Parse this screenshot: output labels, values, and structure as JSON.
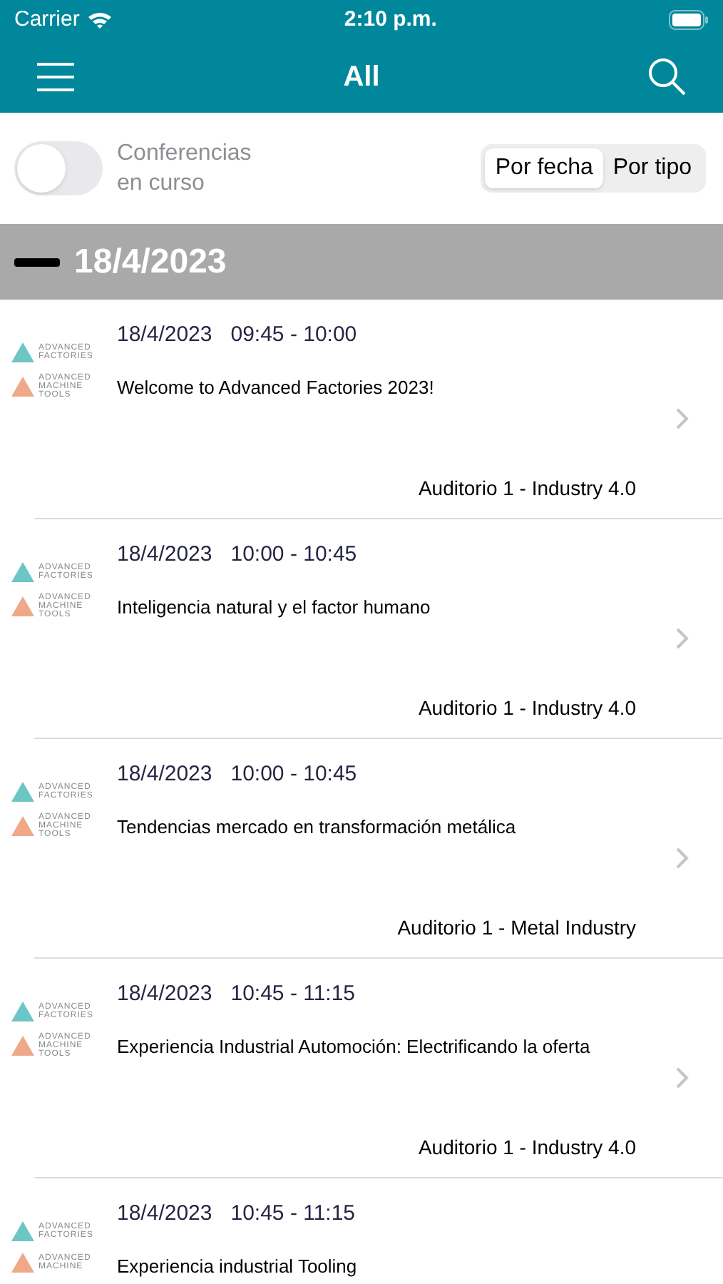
{
  "status_bar": {
    "carrier": "Carrier",
    "time": "2:10 p.m."
  },
  "nav": {
    "title": "All"
  },
  "filter": {
    "toggle_label": "Conferencias en curso",
    "on": false,
    "segments": [
      {
        "label": "Por fecha",
        "selected": true
      },
      {
        "label": "Por tipo",
        "selected": false
      }
    ]
  },
  "section": {
    "date": "18/4/2023"
  },
  "sessions": [
    {
      "date": "18/4/2023",
      "time": "09:45 - 10:00",
      "title": "Welcome to Advanced Factories 2023!",
      "location": "Auditorio 1 - Industry 4.0",
      "logos": [
        "ADVANCED FACTORIES",
        "ADVANCED MACHINE TOOLS"
      ]
    },
    {
      "date": "18/4/2023",
      "time": "10:00 - 10:45",
      "title": "Inteligencia natural y el factor humano",
      "location": "Auditorio 1 - Industry 4.0",
      "logos": [
        "ADVANCED FACTORIES",
        "ADVANCED MACHINE TOOLS"
      ]
    },
    {
      "date": "18/4/2023",
      "time": "10:00 - 10:45",
      "title": "Tendencias mercado en transformación metálica",
      "location": "Auditorio 1 - Metal Industry",
      "logos": [
        "ADVANCED FACTORIES",
        "ADVANCED MACHINE TOOLS"
      ]
    },
    {
      "date": "18/4/2023",
      "time": "10:45 - 11:15",
      "title": "Experiencia Industrial Automoción: Electrificando la oferta",
      "location": "Auditorio 1 - Industry 4.0",
      "logos": [
        "ADVANCED FACTORIES",
        "ADVANCED MACHINE TOOLS"
      ]
    },
    {
      "date": "18/4/2023",
      "time": "10:45 - 11:15",
      "title": "Experiencia industrial Tooling",
      "logos": [
        "ADVANCED FACTORIES",
        "ADVANCED MACHINE"
      ]
    }
  ]
}
